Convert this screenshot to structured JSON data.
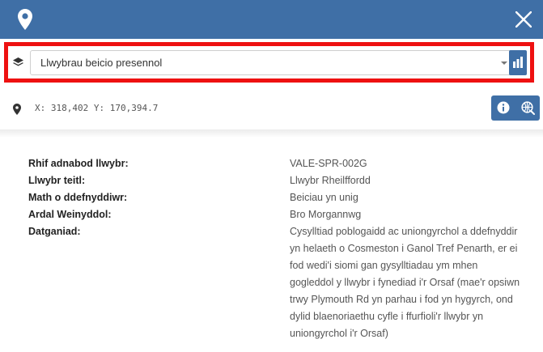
{
  "layer_selector": {
    "selected_layer": "Llwybrau beicio presennol"
  },
  "coordinates": {
    "text": "X: 318,402 Y: 170,394.7"
  },
  "feature_attributes": [
    {
      "label": "Rhif adnabod llwybr:",
      "value": "VALE-SPR-002G"
    },
    {
      "label": "Llwybr teitl:",
      "value": "Llwybr Rheilffordd"
    },
    {
      "label": "Math o ddefnyddiwr:",
      "value": "Beiciau yn unig"
    },
    {
      "label": "Ardal Weinyddol:",
      "value": "Bro Morgannwg"
    },
    {
      "label": "Datganiad:",
      "value": "Cysylltiad poblogaidd ac uniongyrchol a ddefnyddir yn helaeth o Cosmeston i Ganol Tref Penarth, er ei fod wedi'i siomi gan gysylltiadau ym mhen gogleddol y llwybr i fynediad i'r Orsaf (mae'r opsiwn trwy Plymouth Rd yn parhau i fod yn hygyrch, ond dylid blaenoriaethu cyfle i ffurfioli'r llwybr yn uniongyrchol i'r Orsaf)"
    }
  ],
  "icons": {
    "header_pin": "map-pin-icon",
    "close": "close-icon",
    "layers": "layers-icon",
    "chart": "bar-chart-icon",
    "coord_pin": "map-pin-icon",
    "info": "info-icon",
    "globe": "globe-search-icon"
  },
  "colors": {
    "header": "#3f6fa6",
    "highlight_border": "#ee1111",
    "button": "#3f6fa6"
  }
}
